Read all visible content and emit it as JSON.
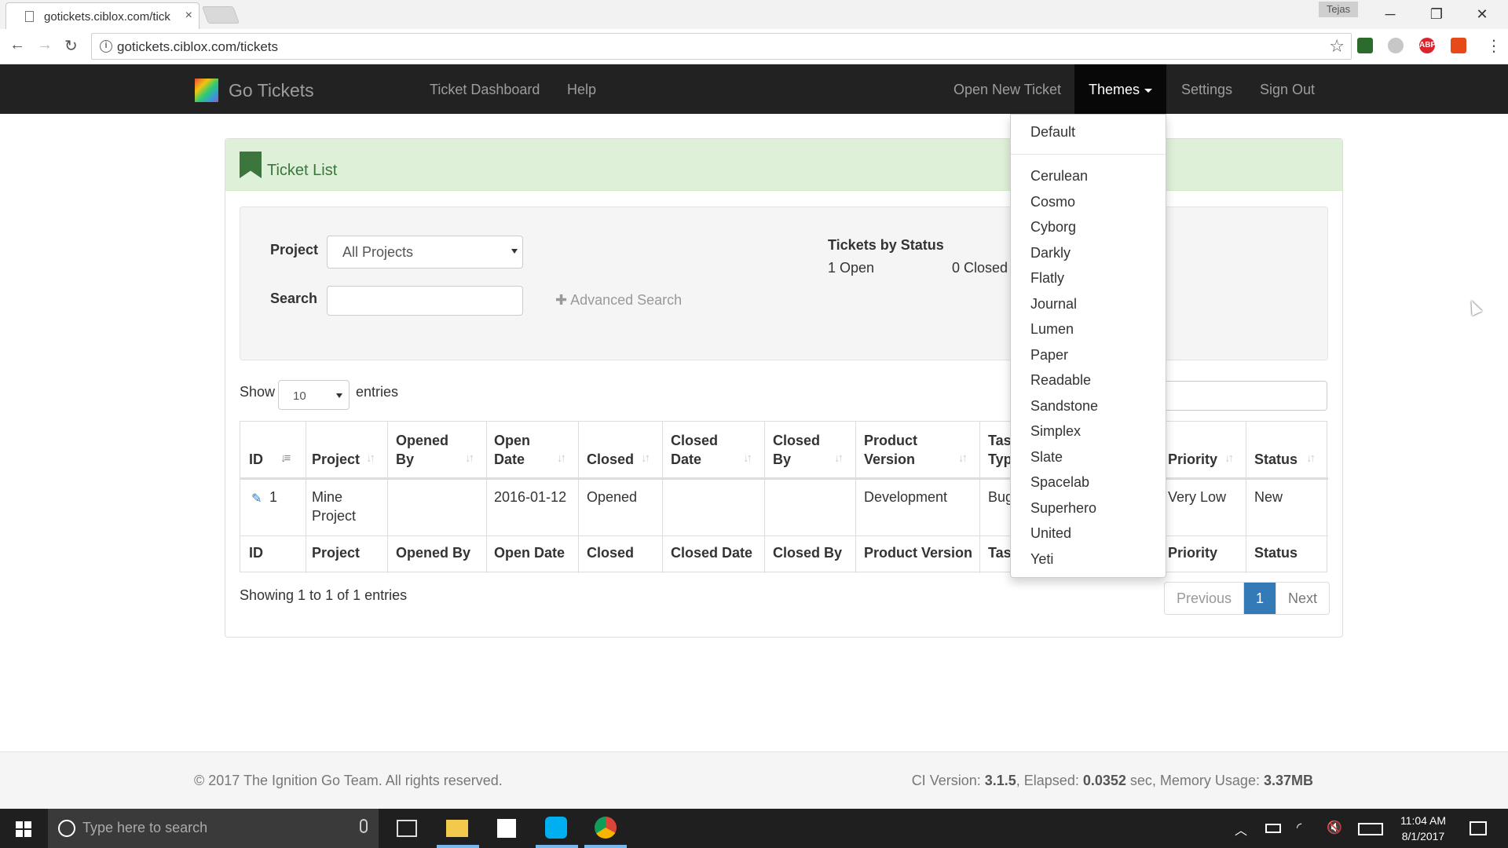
{
  "browser": {
    "tab_title": "gotickets.ciblox.com/tick",
    "tab_close": "×",
    "profile_name": "Tejas",
    "url": "gotickets.ciblox.com/tickets",
    "win_min": "─",
    "win_restore": "❐",
    "win_close": "✕",
    "back": "←",
    "forward": "→",
    "reload": "↻",
    "info": "i",
    "star": "☆",
    "menu": "⋮",
    "ext_abp": "ABP"
  },
  "navbar": {
    "brand": "Go Tickets",
    "links": {
      "dashboard": "Ticket Dashboard",
      "help": "Help",
      "open_new": "Open New Ticket",
      "themes": "Themes",
      "settings": "Settings",
      "sign_out": "Sign Out"
    }
  },
  "panel": {
    "title": "Ticket List"
  },
  "filters": {
    "project_label": "Project",
    "project_value": "All Projects",
    "search_label": "Search",
    "search_value": "",
    "advanced_search": "✚ Advanced Search",
    "stats_title": "Tickets by Status",
    "open_count": "1 Open",
    "closed_count": "0 Closed"
  },
  "length": {
    "show": "Show",
    "value": "10",
    "entries": "entries"
  },
  "table": {
    "header": {
      "id": "ID",
      "project": "Project",
      "opened_by_1": "Opened",
      "opened_by_2": "By",
      "open_date_1": "Open",
      "open_date_2": "Date",
      "closed": "Closed",
      "closed_date_1": "Closed",
      "closed_date_2": "Date",
      "closed_by_1": "Closed",
      "closed_by_2": "By",
      "product_version_1": "Product",
      "product_version_2": "Version",
      "task_type_1": "Tas",
      "task_type_2": "Typ",
      "priority": "Priority",
      "status": "Status"
    },
    "row": {
      "id": "1",
      "project_1": "Mine",
      "project_2": "Project",
      "opened_by": "",
      "open_date": "2016-01-12",
      "closed": "Opened",
      "closed_date": "",
      "closed_by": "",
      "product_version": "Development",
      "task_type": "Bug",
      "priority": "Very Low",
      "status": "New"
    },
    "footer": {
      "id": "ID",
      "project": "Project",
      "opened_by": "Opened By",
      "open_date": "Open Date",
      "closed": "Closed",
      "closed_date": "Closed Date",
      "closed_by": "Closed By",
      "product_version": "Product Version",
      "task_type": "Tas",
      "priority": "Priority",
      "status": "Status"
    },
    "sort_icon": "↓↑",
    "sort_icon_active": "↓≡",
    "edit_icon": "✎"
  },
  "info": "Showing 1 to 1 of 1 entries",
  "pagination": {
    "previous": "Previous",
    "current": "1",
    "next": "Next"
  },
  "themes_menu": {
    "default": "Default",
    "items": [
      "Cerulean",
      "Cosmo",
      "Cyborg",
      "Darkly",
      "Flatly",
      "Journal",
      "Lumen",
      "Paper",
      "Readable",
      "Sandstone",
      "Simplex",
      "Slate",
      "Spacelab",
      "Superhero",
      "United",
      "Yeti"
    ]
  },
  "footer": {
    "copyright": "© 2017 The Ignition Go Team. All rights reserved.",
    "ci_label": "CI Version: ",
    "ci_version": "3.1.5",
    "elapsed_label": ", Elapsed: ",
    "elapsed": "0.0352",
    "sec_label": " sec, Memory Usage: ",
    "memory": "3.37MB"
  },
  "taskbar": {
    "search_placeholder": "Type here to search",
    "time": "11:04 AM",
    "date": "8/1/2017"
  },
  "colors": {
    "navbar_bg": "#222222",
    "panel_success": "#dff0d8",
    "primary": "#337ab7"
  }
}
